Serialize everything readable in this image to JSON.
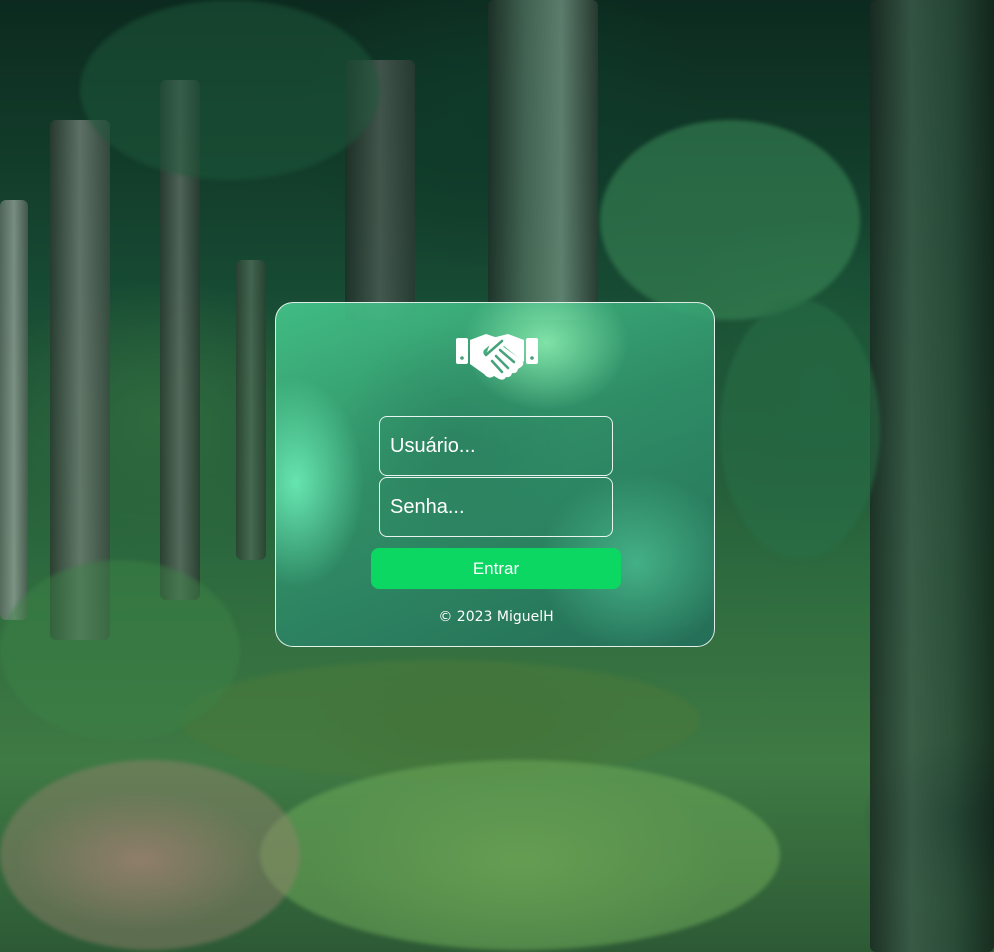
{
  "background": {
    "icon": "forest-scene",
    "colors": {
      "canopy": "#0c2a1f",
      "foliage": "#2d6a3e",
      "grass": "#5b8f4a",
      "path": "#8a7a66"
    }
  },
  "login_card": {
    "logo_icon": "handshake-icon",
    "username": {
      "placeholder": "Usuário...",
      "value": ""
    },
    "password": {
      "placeholder": "Senha...",
      "value": ""
    },
    "submit_label": "Entrar",
    "footer_text": "© 2023 MiguelH",
    "colors": {
      "button": "#0bd762",
      "text": "#ffffff",
      "border": "#ffffff"
    }
  }
}
